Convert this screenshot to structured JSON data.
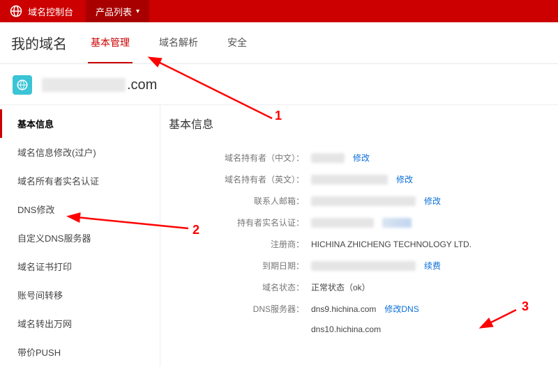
{
  "topbar": {
    "console_title": "域名控制台",
    "products_label": "产品列表"
  },
  "page_title": "我的域名",
  "tabs": [
    {
      "label": "基本管理",
      "active": true
    },
    {
      "label": "域名解析",
      "active": false
    },
    {
      "label": "安全",
      "active": false
    }
  ],
  "domain": {
    "suffix_visible": ".com"
  },
  "sidebar": {
    "items": [
      {
        "label": "基本信息",
        "active": true
      },
      {
        "label": "域名信息修改(过户)"
      },
      {
        "label": "域名所有者实名认证"
      },
      {
        "label": "DNS修改"
      },
      {
        "label": "自定义DNS服务器"
      },
      {
        "label": "域名证书打印"
      },
      {
        "label": "账号间转移"
      },
      {
        "label": "域名转出万网"
      },
      {
        "label": "带价PUSH"
      }
    ]
  },
  "content": {
    "section_title": "基本信息",
    "rows": {
      "owner_cn_label": "域名持有者（中文）：",
      "owner_en_label": "域名持有者（英文）：",
      "contact_email_label": "联系人邮箱：",
      "realname_label": "持有者实名认证：",
      "registrar_label": "注册商：",
      "registrar_value": "HICHINA ZHICHENG TECHNOLOGY LTD.",
      "expire_label": "到期日期：",
      "status_label": "域名状态：",
      "status_value": "正常状态（ok）",
      "dns_label": "DNS服务器：",
      "dns1": "dns9.hichina.com",
      "dns2": "dns10.hichina.com"
    },
    "links": {
      "modify": "修改",
      "renew": "续费",
      "modify_dns": "修改DNS"
    }
  },
  "annotations": {
    "n1": "1",
    "n2": "2",
    "n3": "3"
  }
}
